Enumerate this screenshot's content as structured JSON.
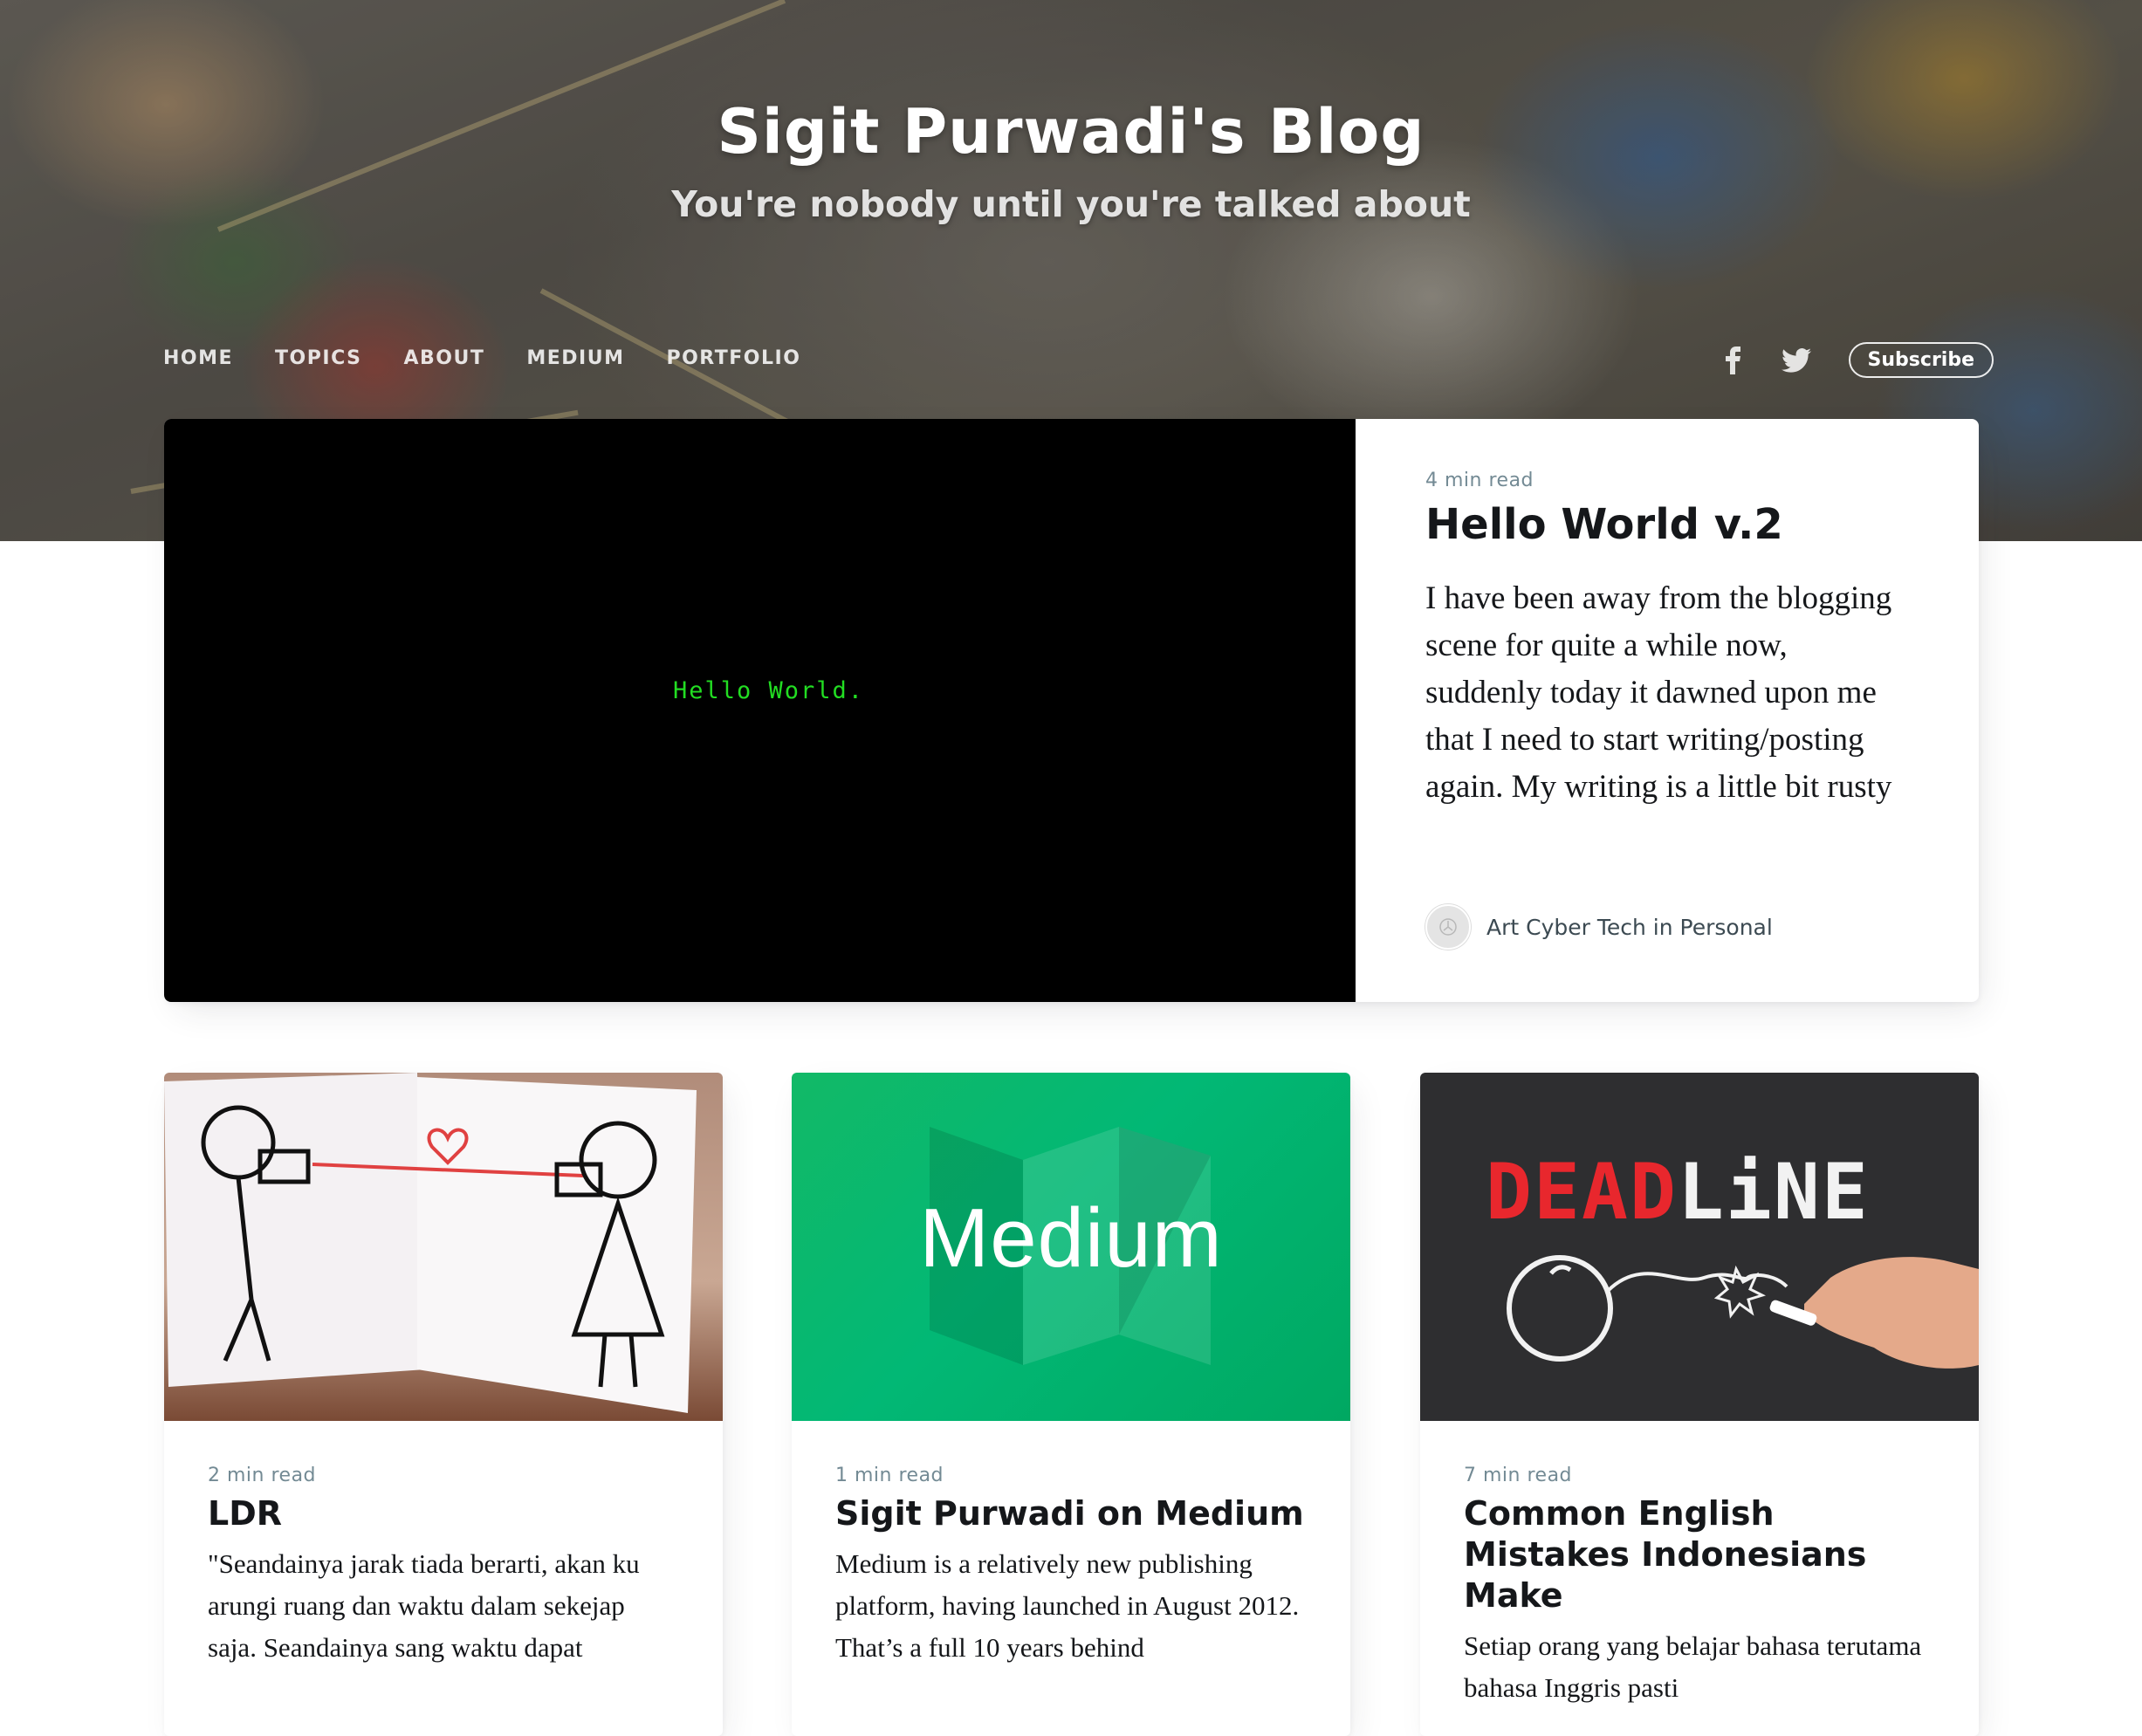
{
  "header": {
    "title": "Sigit Purwadi's Blog",
    "description": "You're nobody until you're talked about",
    "nav": [
      "Home",
      "Topics",
      "About",
      "Medium",
      "Portfolio"
    ],
    "social_icons": [
      "facebook-icon",
      "twitter-icon"
    ],
    "subscribe_label": "Subscribe"
  },
  "featured": {
    "image_text": "Hello World.",
    "reading_time": "4 min read",
    "title": "Hello World v.2",
    "excerpt": "I have been away from the blogging scene for quite a while now, suddenly today it dawned upon me that I need to start writing/posting again. My writing is a little bit rusty",
    "meta": "Art Cyber Tech in Personal"
  },
  "posts": [
    {
      "reading_time": "2 min read",
      "title": "LDR",
      "excerpt": "\"Seandainya jarak tiada berarti, akan ku arungi ruang dan waktu dalam sekejap saja. Seandainya sang waktu dapat"
    },
    {
      "image_text": "Medium",
      "reading_time": "1 min read",
      "title": "Sigit Purwadi on Medium",
      "excerpt": "Medium is a relatively new publishing platform, having launched in August 2012. That’s a full 10 years behind"
    },
    {
      "image_text_red": "DEAD",
      "image_text_white": "LiNE",
      "reading_time": "7 min read",
      "title": "Common English Mistakes Indonesians Make",
      "excerpt": "Setiap orang yang belajar bahasa terutama bahasa Inggris pasti"
    }
  ]
}
